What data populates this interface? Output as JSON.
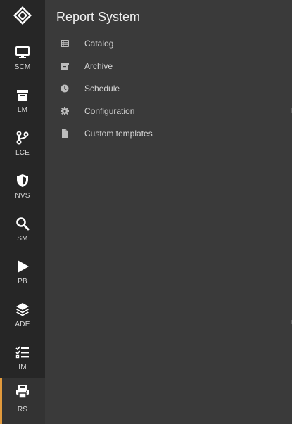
{
  "rail": {
    "items": [
      {
        "label": "SCM",
        "icon": "monitor-icon"
      },
      {
        "label": "LM",
        "icon": "archive-box-icon"
      },
      {
        "label": "LCE",
        "icon": "git-branch-icon"
      },
      {
        "label": "NVS",
        "icon": "shield-icon"
      },
      {
        "label": "SM",
        "icon": "search-icon"
      },
      {
        "label": "PB",
        "icon": "play-icon"
      },
      {
        "label": "ADE",
        "icon": "layers-icon"
      },
      {
        "label": "IM",
        "icon": "checklist-icon"
      },
      {
        "label": "RS",
        "icon": "printer-icon"
      }
    ],
    "active": "RS",
    "accent_color": "#e29a3c",
    "logo_icon": "diamond-logo-icon"
  },
  "panel": {
    "title": "Report System",
    "items": [
      {
        "label": "Catalog",
        "icon": "list-icon"
      },
      {
        "label": "Archive",
        "icon": "archive-icon"
      },
      {
        "label": "Schedule",
        "icon": "clock-icon"
      },
      {
        "label": "Configuration",
        "icon": "gear-icon"
      },
      {
        "label": "Custom templates",
        "icon": "file-icon"
      }
    ]
  }
}
